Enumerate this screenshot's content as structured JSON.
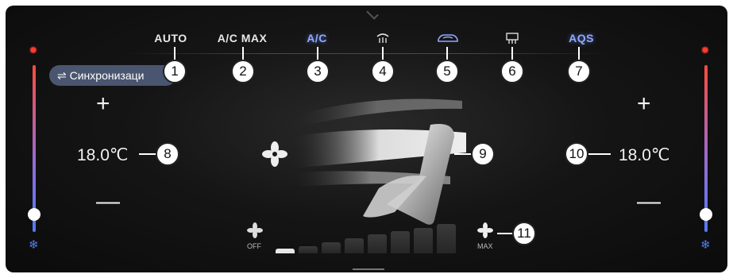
{
  "top_buttons": [
    {
      "label": "AUTO"
    },
    {
      "label": "A/C MAX"
    },
    {
      "label": "A/C"
    },
    {
      "label": "",
      "icon": "front-defrost-icon"
    },
    {
      "label": "",
      "icon": "recirculation-icon"
    },
    {
      "label": "",
      "icon": "rear-defrost-icon"
    },
    {
      "label": "AQS"
    }
  ],
  "sync_button": {
    "label": "⇌ Синхронизаци"
  },
  "left_zone": {
    "temperature": "18.0℃",
    "plus": "+",
    "minus": "—",
    "slider_level": 0.06
  },
  "right_zone": {
    "temperature": "18.0℃",
    "plus": "+",
    "minus": "—",
    "slider_level": 0.06
  },
  "fan": {
    "off_label": "OFF",
    "max_label": "MAX",
    "levels": 8,
    "active_level": 1
  },
  "callouts": [
    "1",
    "2",
    "3",
    "4",
    "5",
    "6",
    "7",
    "8",
    "9",
    "10",
    "11"
  ],
  "colors": {
    "accent_blue": "#8fa8ff",
    "hot": "#ff3b2f",
    "cold": "#4f7bff",
    "sync_bg": "#4a5670"
  }
}
